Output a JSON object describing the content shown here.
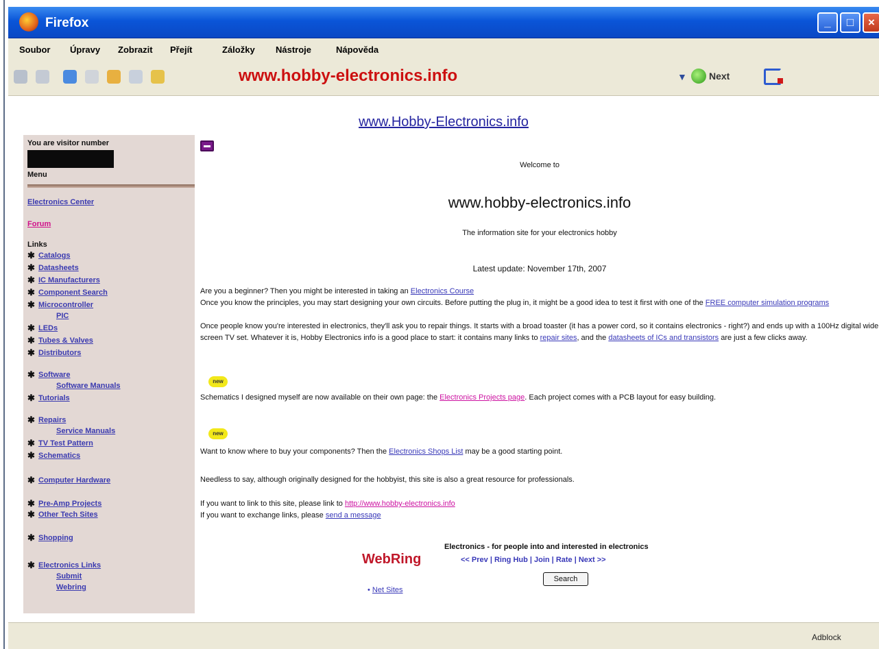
{
  "window": {
    "title": "Firefox"
  },
  "menu": [
    "Soubor",
    "Úpravy",
    "Zobrazit",
    "Přejít",
    "Záložky",
    "Nástroje",
    "Nápověda"
  ],
  "toolbar": {
    "url": "www.hobby-electronics.info",
    "go_label": "Next"
  },
  "site": {
    "title": "www.Hobby-Electronics.info"
  },
  "sidebar": {
    "visitor_label": "You are visitor number",
    "menu_heading": "Menu",
    "top_links": [
      "Electronics Center",
      "Forum"
    ],
    "links_heading": "Links",
    "items": [
      {
        "label": "Catalogs"
      },
      {
        "label": "Datasheets"
      },
      {
        "label": "IC Manufacturers"
      },
      {
        "label": "Component Search"
      },
      {
        "label": "Microcontroller",
        "sub": "PIC"
      },
      {
        "label": "LEDs"
      },
      {
        "label": "Tubes & Valves"
      },
      {
        "label": "Distributors"
      },
      {
        "label": "Software",
        "sub": "Software Manuals"
      },
      {
        "label": "Tutorials"
      },
      {
        "label": "Repairs",
        "sub": "Service Manuals"
      },
      {
        "label": "TV Test Pattern"
      },
      {
        "label": "Schematics"
      },
      {
        "label": "Computer Hardware"
      },
      {
        "label": "Pre-Amp Projects"
      },
      {
        "label": "Other Tech Sites"
      },
      {
        "label": "Shopping"
      },
      {
        "label": "Electronics Links",
        "sub": "Submit",
        "sub2": "Webring"
      }
    ]
  },
  "main": {
    "notice_link": "",
    "welcome": "Welcome to",
    "heading": "www.hobby-electronics.info",
    "tagline": "The information site for your electronics hobby",
    "latest_update": "Latest update: November 17th, 2007",
    "p1_text": "Are you a beginner? Then you might be interested in taking an",
    "p1_link": "Electronics Course",
    "p2_text": "Once you know the principles, you may start designing your own circuits. Before putting the plug in, it might be a good idea to test it first with one of the",
    "p2_link": "FREE computer simulation programs",
    "p3_text": "Once people know you're interested in electronics, they'll ask you to repair things. It starts with a broad toaster (it has a power cord, so it contains electronics - right?) and ends up with a 100Hz digital wide screen TV set. Whatever it is, Hobby Electronics info is a good place to start: it contains many links to",
    "p3_link1": "repair sites",
    "p3_mid": ", and the",
    "p3_link2": "datasheets of ICs and transistors",
    "p3_end": " are just a few clicks away.",
    "badge": "new",
    "p4_text": "Schematics I designed myself are now available on their own page: the",
    "p4_link": "Electronics Projects page",
    "p4_end": ". Each project comes with a PCB layout for easy building.",
    "p5_text": "Want to know where to buy your components? Then the",
    "p5_link": "Electronics Shops List",
    "p5_end": " may be a good starting point.",
    "p6_text": "Needless to say, although originally designed for the hobbyist, this site is also a great resource for professionals.",
    "p7_text": "If you want to link to this site, please link to",
    "p7_link": "http://www.hobby-electronics.info",
    "p8_text": "If you want to exchange links, please",
    "p8_link": "send a message",
    "webring_logo": "WebRing",
    "webring_title": "Electronics - for people into and interested in electronics",
    "webring_nav": "<< Prev | Ring Hub | Join | Rate | Next >>",
    "webring_search": "Search",
    "webring_bullet": "• ",
    "webring_bullet_link": "Net Sites"
  },
  "status": {
    "right": "Adblock"
  }
}
